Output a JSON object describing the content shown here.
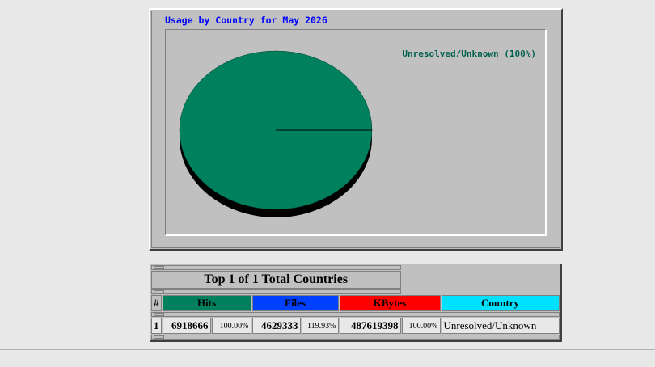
{
  "chart": {
    "title": "Usage by Country for May 2026",
    "colors": {
      "slice": "#00805c",
      "shadow": "#000000",
      "legend_text": "#006050",
      "title_text": "#0000ff"
    }
  },
  "chart_data": {
    "type": "pie",
    "title": "Usage by Country for May 2026",
    "slices": [
      {
        "label": "Unresolved/Unknown (100%)",
        "value": 100
      }
    ]
  },
  "table": {
    "title": "Top 1 of 1 Total Countries",
    "headers": {
      "rank": "#",
      "hits": "Hits",
      "files": "Files",
      "kbytes": "KBytes",
      "country": "Country"
    },
    "header_colors": {
      "hits": "#00805c",
      "files": "#0040ff",
      "kbytes": "#ff0000",
      "country": "#00e0ff"
    },
    "rows": [
      {
        "rank": "1",
        "hits": "6918666",
        "hits_pct": "100.00%",
        "files": "4629333",
        "files_pct": "119.93%",
        "kbytes": "487619398",
        "kbytes_pct": "100.00%",
        "country": "Unresolved/Unknown"
      }
    ]
  }
}
